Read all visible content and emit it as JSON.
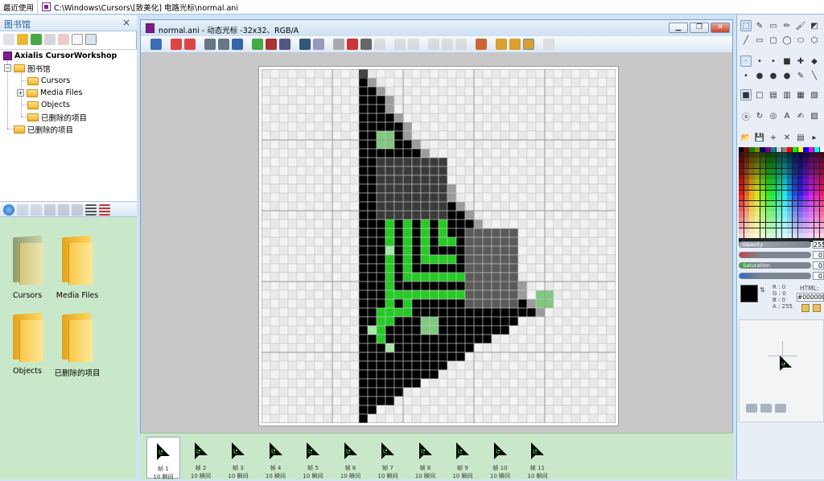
{
  "topbar": {
    "recent_tab": "最近使用",
    "path": "C:\\Windows\\Cursors\\[致美化] 电路光标\\normal.ani"
  },
  "library": {
    "title": "图书馆",
    "close": "×",
    "tree": {
      "root": "Axialis CursorWorkshop",
      "library_node": "图书馆",
      "children": [
        "Cursors",
        "Media Files",
        "Objects",
        "已删除的项目"
      ],
      "deleted_node": "已删除的项目"
    },
    "files": [
      {
        "label": "Cursors"
      },
      {
        "label": "Media Files"
      },
      {
        "label": "Objects"
      },
      {
        "label": "已删除的项目"
      }
    ]
  },
  "document": {
    "title": "normal.ani - 动态光标 -32x32、RGB/A",
    "min": "▁",
    "restore": "❐",
    "close": "✕"
  },
  "colors": {
    "black": "#000000",
    "dark_gray": "#3a3a3a",
    "mid_gray": "#5a5a5a",
    "green": "#22cc22",
    "light_green": "#7fc97f",
    "pale_green": "#a8e6a8",
    "accent_purple": "#7b1c8c"
  },
  "frames": [
    {
      "name": "帧 1",
      "dur": "10 瞬间"
    },
    {
      "name": "帧 2",
      "dur": "10 瞬间"
    },
    {
      "name": "帧 3",
      "dur": "10 瞬间"
    },
    {
      "name": "帧 4",
      "dur": "10 瞬间"
    },
    {
      "name": "帧 5",
      "dur": "10 瞬间"
    },
    {
      "name": "帧 6",
      "dur": "10 瞬间"
    },
    {
      "name": "帧 7",
      "dur": "10 瞬间"
    },
    {
      "name": "帧 8",
      "dur": "10 瞬间"
    },
    {
      "name": "帧 9",
      "dur": "10 瞬间"
    },
    {
      "name": "帧 10",
      "dur": "10 瞬间"
    },
    {
      "name": "帧 11",
      "dur": "10 瞬间"
    }
  ],
  "color_panel": {
    "opacity_label": "Opacity",
    "opacity_value": "255",
    "hue_label": "",
    "hue_value": "0",
    "sat_label": "Saturation",
    "sat_value": "0",
    "lum_label": "",
    "lum_value": "0",
    "r_label": "R :",
    "r_value": "0",
    "g_label": "G :",
    "g_value": "0",
    "b_label": "B :",
    "b_value": "0",
    "a_label": "A :",
    "a_value": "255",
    "html_label": "HTML:",
    "html_value": "#000000"
  }
}
